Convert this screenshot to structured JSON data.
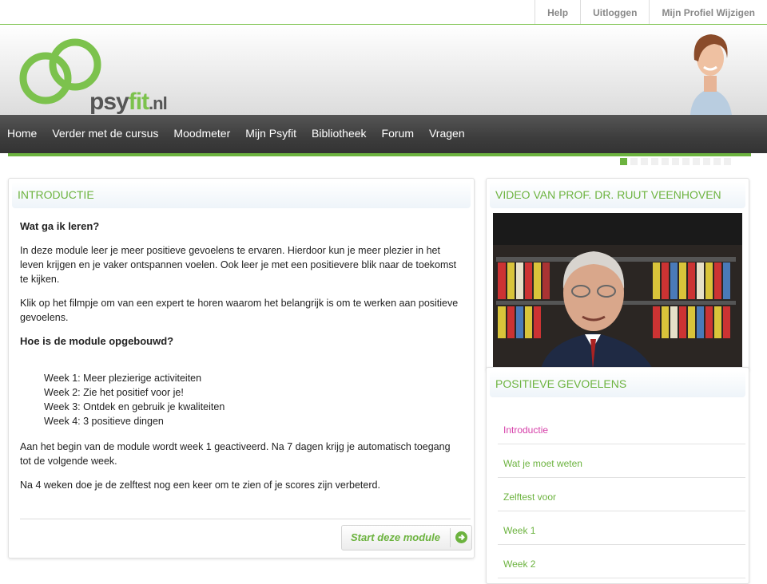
{
  "top_links": [
    "Help",
    "Uitloggen",
    "Mijn Profiel Wijzigen"
  ],
  "logo": {
    "part1": "psy",
    "part2": "fit",
    "part3": ".nl"
  },
  "nav": [
    "Home",
    "Verder met de cursus",
    "Moodmeter",
    "Mijn Psyfit",
    "Bibliotheek",
    "Forum",
    "Vragen"
  ],
  "progress": {
    "total_steps": 11,
    "active_index": 0
  },
  "intro": {
    "title": "INTRODUCTIE",
    "heading1": "Wat ga ik leren?",
    "p1": "In deze module leer je meer positieve gevoelens te ervaren. Hierdoor kun je meer plezier in het leven krijgen en je vaker ontspannen voelen. Ook leer je met een positievere blik naar de toekomst te kijken.",
    "p2": "Klik op het filmpje om van een expert te horen waarom het belangrijk is om te werken aan positieve gevoelens.",
    "heading2": "Hoe is de module opgebouwd?",
    "weeks": [
      "Week 1: Meer plezierige activiteiten",
      "Week 2: Zie het positief voor je!",
      "Week 3: Ontdek en gebruik je kwaliteiten",
      "Week 4: 3 positieve dingen"
    ],
    "p3": "Aan het begin van de module wordt week 1 geactiveerd. Na 7 dagen krijg je automatisch toegang tot de volgende week.",
    "p4": "Na 4 weken doe je de zelftest nog een keer om te zien of je scores zijn verbeterd.",
    "button": "Start deze module"
  },
  "video": {
    "title": "VIDEO VAN PROF. DR. RUUT VEENHOVEN"
  },
  "module_menu": {
    "title": "POSITIEVE GEVOELENS",
    "items": [
      "Introductie",
      "Wat je moet weten",
      "Zelftest voor",
      "Week 1",
      "Week 2"
    ],
    "active": "Introductie"
  },
  "colors": {
    "accent": "#6cb33f",
    "active_link": "#d63fa9",
    "nav_bg": "#3d3d3d"
  }
}
